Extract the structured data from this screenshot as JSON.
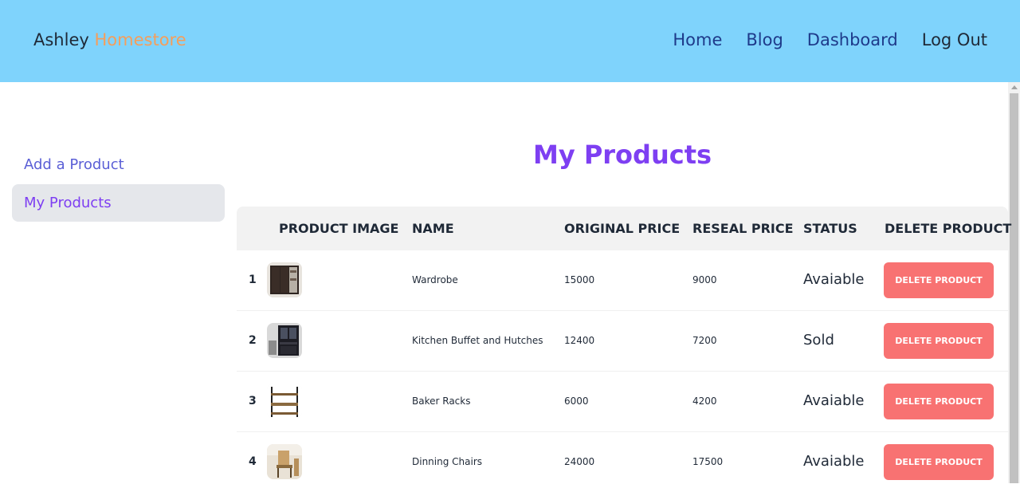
{
  "brand": {
    "first": "Ashley",
    "second": "Homestore"
  },
  "nav": {
    "home": "Home",
    "blog": "Blog",
    "dashboard": "Dashboard",
    "logout": "Log Out"
  },
  "sidebar": {
    "items": [
      {
        "label": "Add a Product"
      },
      {
        "label": "My Products"
      }
    ]
  },
  "page": {
    "title": "My Products"
  },
  "table": {
    "headers": {
      "image": "PRODUCT IMAGE",
      "name": "NAME",
      "original": "ORIGINAL PRICE",
      "resale": "RESEAL PRICE",
      "status": "STATUS",
      "delete": "DELETE PRODUCT"
    },
    "rows": [
      {
        "index": "1",
        "name": "Wardrobe",
        "original_price": "15000",
        "resale_price": "9000",
        "status": "Avaiable",
        "delete_label": "Delete Product",
        "image_icon": "wardrobe-image"
      },
      {
        "index": "2",
        "name": "Kitchen Buffet and Hutches",
        "original_price": "12400",
        "resale_price": "7200",
        "status": "Sold",
        "delete_label": "Delete Product",
        "image_icon": "kitchen-hutch-image"
      },
      {
        "index": "3",
        "name": "Baker Racks",
        "original_price": "6000",
        "resale_price": "4200",
        "status": "Avaiable",
        "delete_label": "Delete Product",
        "image_icon": "baker-rack-image"
      },
      {
        "index": "4",
        "name": "Dinning Chairs",
        "original_price": "24000",
        "resale_price": "17500",
        "status": "Avaiable",
        "delete_label": "Delete Product",
        "image_icon": "dining-chair-image"
      }
    ]
  },
  "colors": {
    "navbar": "#7fd3fc",
    "accent_orange": "#f59e5b",
    "title_purple": "#7e3ff2",
    "delete_button": "#f87272"
  }
}
